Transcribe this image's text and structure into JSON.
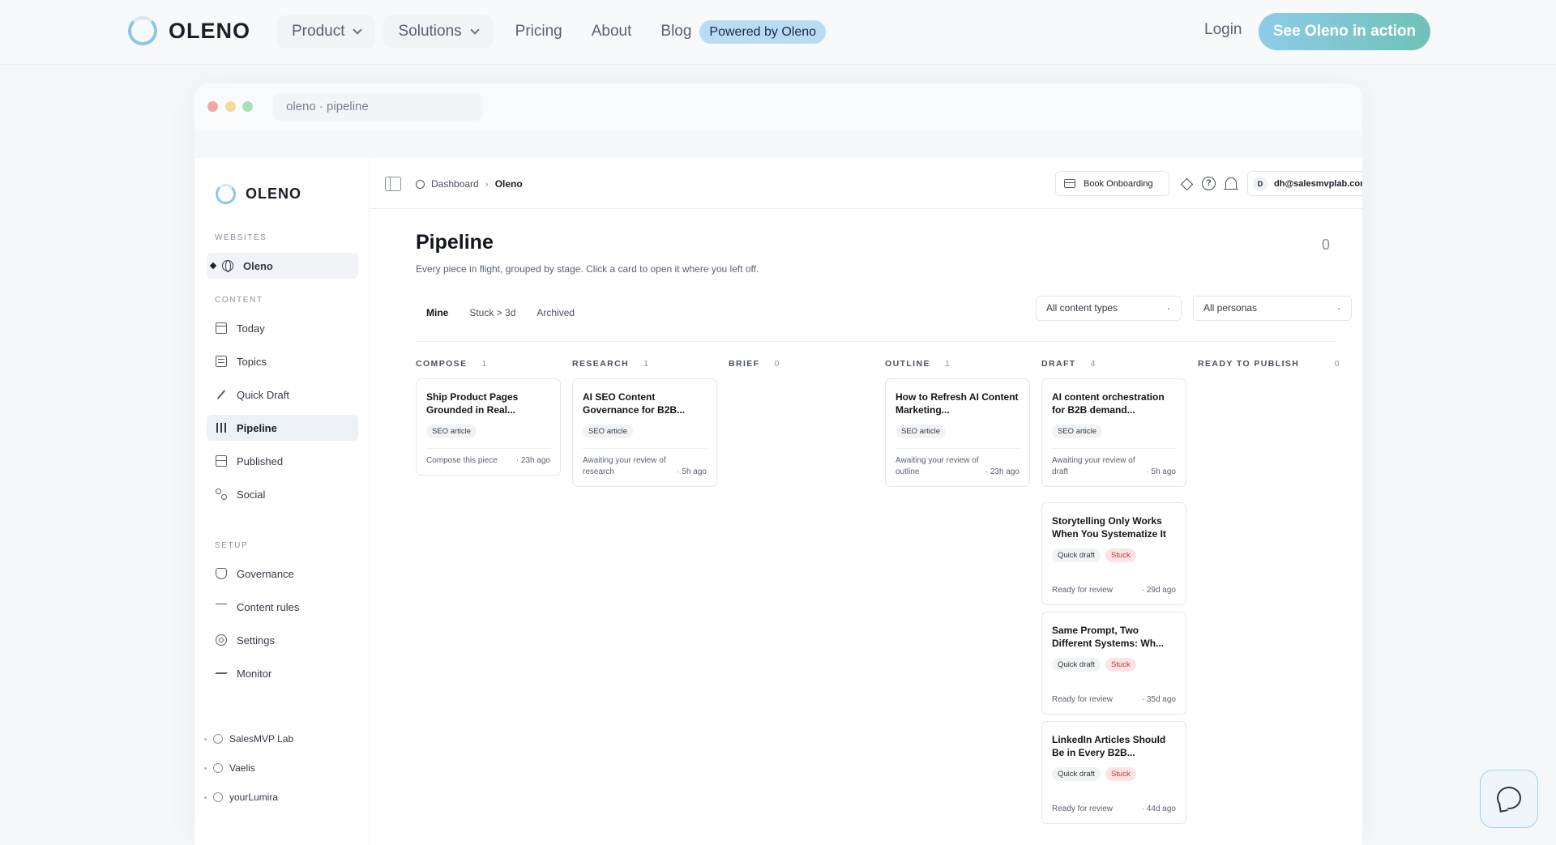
{
  "topnav": {
    "brand": "OLENO",
    "items": [
      {
        "label": "Product",
        "dropdown": true
      },
      {
        "label": "Solutions",
        "dropdown": true
      },
      {
        "label": "Pricing"
      },
      {
        "label": "About"
      },
      {
        "label": "Blog"
      }
    ],
    "powered": "Powered by Oleno",
    "login": "Login",
    "cta": "See Oleno in action"
  },
  "window": {
    "url": "oleno · pipeline"
  },
  "sidebar": {
    "brand": "OLENO",
    "websites_label": "WEBSITES",
    "site": "Oleno",
    "content_label": "CONTENT",
    "content_items": [
      {
        "label": "Today",
        "icon": "calendar-icon"
      },
      {
        "label": "Topics",
        "icon": "list-icon"
      },
      {
        "label": "Quick Draft",
        "icon": "pencil-icon"
      },
      {
        "label": "Pipeline",
        "icon": "columns-icon",
        "active": true
      },
      {
        "label": "Published",
        "icon": "published-icon"
      },
      {
        "label": "Social",
        "icon": "social-icon"
      }
    ],
    "setup_label": "SETUP",
    "setup_items": [
      {
        "label": "Governance",
        "icon": "shield-icon"
      },
      {
        "label": "Content rules",
        "icon": "sliders-icon"
      },
      {
        "label": "Settings",
        "icon": "gear-icon"
      },
      {
        "label": "Monitor",
        "icon": "pulse-icon"
      }
    ],
    "workspaces": [
      "SalesMVP Lab",
      "Vaelis",
      "yourLumira"
    ]
  },
  "topbar": {
    "crumb_root": "Dashboard",
    "crumb_sep": "›",
    "crumb_current": "Oleno",
    "book": "Book Onboarding",
    "help": "?",
    "avatar": "D",
    "user": "dh@salesmvplab.com"
  },
  "page": {
    "title": "Pipeline",
    "count": "0",
    "subtitle": "Every piece in flight, grouped by stage. Click a card to open it where you left off.",
    "tabs": [
      "Mine",
      "Stuck > 3d",
      "Archived"
    ],
    "filter_types": "All content types",
    "filter_personas": "All personas"
  },
  "columns": [
    {
      "name": "COMPOSE",
      "count": "1"
    },
    {
      "name": "RESEARCH",
      "count": "1"
    },
    {
      "name": "BRIEF",
      "count": "0"
    },
    {
      "name": "OUTLINE",
      "count": "1"
    },
    {
      "name": "DRAFT",
      "count": "4"
    },
    {
      "name": "READY TO PUBLISH",
      "count": "0"
    }
  ],
  "cards": [
    {
      "title": "Ship Product Pages Grounded in Real...",
      "tags": [
        "SEO article"
      ],
      "stuck": "",
      "status": "Compose this piece",
      "age": "· 23h ago"
    },
    {
      "title": "AI SEO Content Governance for B2B...",
      "tags": [
        "SEO article"
      ],
      "stuck": "",
      "status": "Awaiting your review of research",
      "age": "· 5h ago"
    },
    {
      "title": "How to Refresh AI Content Marketing...",
      "tags": [
        "SEO article"
      ],
      "stuck": "",
      "status": "Awaiting your review of outline",
      "age": "· 23h ago"
    },
    {
      "title": "AI content orchestration for B2B demand...",
      "tags": [
        "SEO article"
      ],
      "stuck": "",
      "status": "Awaiting your review of draft",
      "age": "· 5h ago"
    },
    {
      "title": "Storytelling Only Works When You Systematize It",
      "tags": [
        "Quick draft"
      ],
      "stuck": "Stuck",
      "status": "Ready for review",
      "age": "· 29d ago"
    },
    {
      "title": "Same Prompt, Two Different Systems: Wh...",
      "tags": [
        "Quick draft"
      ],
      "stuck": "Stuck",
      "status": "Ready for review",
      "age": "· 35d ago"
    },
    {
      "title": "LinkedIn Articles Should Be in Every B2B...",
      "tags": [
        "Quick draft"
      ],
      "stuck": "Stuck",
      "status": "Ready for review",
      "age": "· 44d ago"
    }
  ],
  "colors": {
    "accent": "#8ec3ea",
    "cta_start": "#8ecbe9",
    "cta_end": "#6fc2b6",
    "stuck_bg": "#fde3e3",
    "stuck_fg": "#c9363a"
  }
}
